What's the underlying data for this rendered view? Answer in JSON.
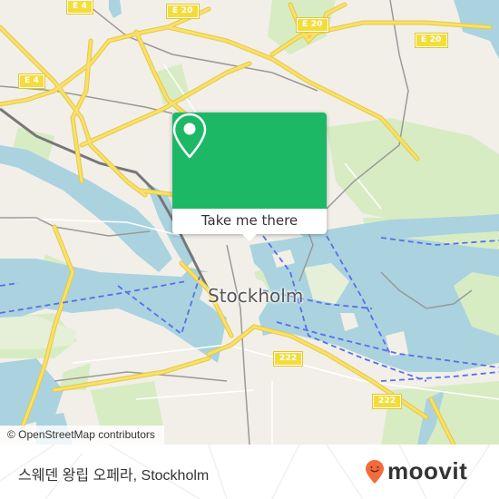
{
  "map": {
    "city_label": "Stockholm",
    "road_shields": [
      {
        "id": "e4-top",
        "label": "E 4"
      },
      {
        "id": "e20-top",
        "label": "E 20"
      },
      {
        "id": "e4-left",
        "label": "E 4"
      },
      {
        "id": "e20-mid",
        "label": "E 20"
      },
      {
        "id": "e20-right",
        "label": "E 20"
      },
      {
        "id": "222-left",
        "label": "222"
      },
      {
        "id": "222-right",
        "label": "222"
      }
    ],
    "attribution": "© OpenStreetMap contributors",
    "colors": {
      "water": "#aad3df",
      "land": "#f2efe9",
      "park": "#d8ecc4",
      "road_major": "#f7e06e",
      "ferry": "#5b6ee8"
    }
  },
  "popup": {
    "icon": "location-pin-icon",
    "button_label": "Take me there",
    "color": "#1cb866"
  },
  "footer": {
    "place_name": "스웨덴 왕립 오페라, Stockholm",
    "brand": "moovit",
    "brand_color": "#f26b3a"
  }
}
